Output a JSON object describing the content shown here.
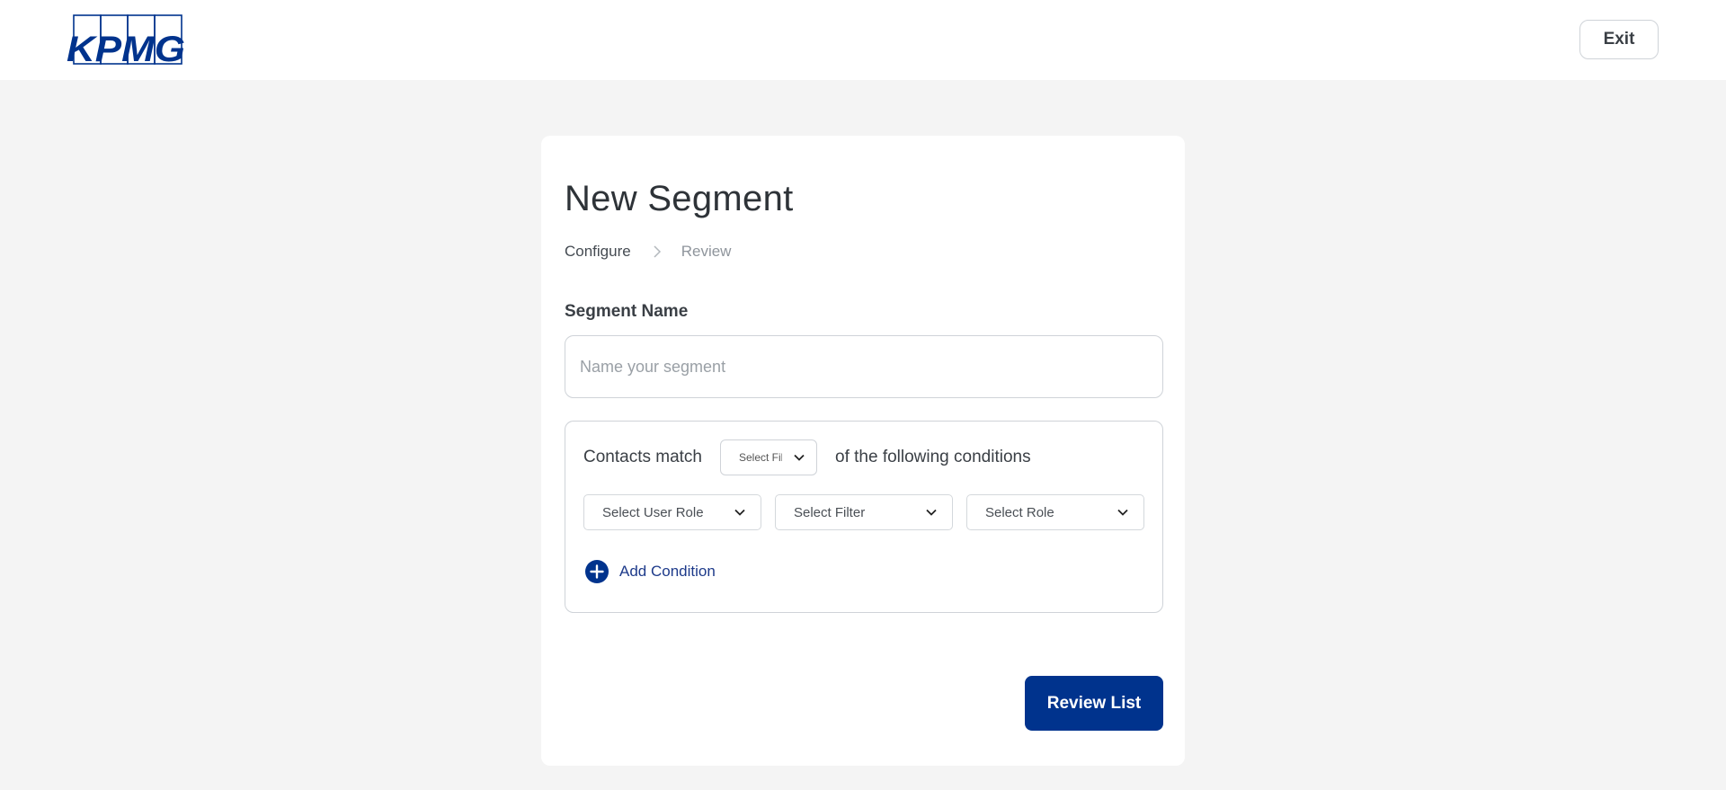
{
  "header": {
    "logo_text": "KPMG",
    "exit_label": "Exit"
  },
  "segment": {
    "title": "New Segment",
    "breadcrumb": {
      "current": "Configure",
      "next": "Review"
    },
    "name_label": "Segment Name",
    "name_placeholder": "Name your segment",
    "name_value": "",
    "conditions": {
      "prefix": "Contacts match",
      "match_select": "Select Filter",
      "suffix": "of the following conditions",
      "filters": [
        {
          "label": "Select User Role"
        },
        {
          "label": "Select Filter"
        },
        {
          "label": "Select Role"
        }
      ],
      "add_label": "Add Condition"
    },
    "review_label": "Review List"
  },
  "colors": {
    "brand": "#00338d",
    "background": "#f4f4f4"
  }
}
